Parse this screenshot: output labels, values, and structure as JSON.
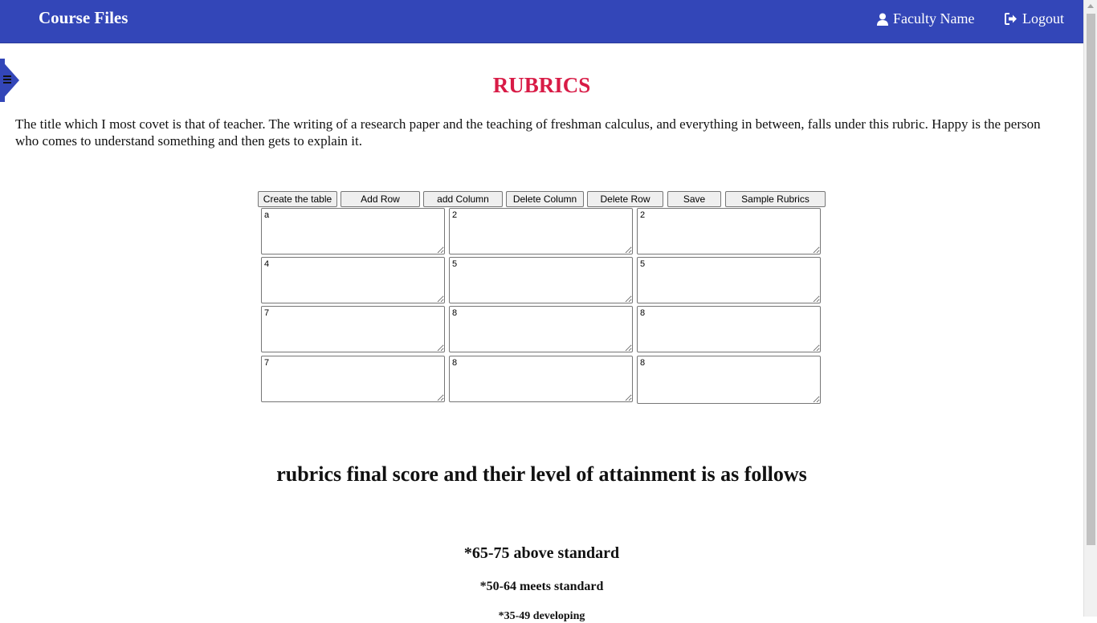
{
  "navbar": {
    "brand": "Course Files",
    "user_label": "Faculty Name",
    "logout_label": "Logout",
    "color": "#3346b8"
  },
  "page": {
    "title": "RUBRICS",
    "title_color": "#d81b46",
    "intro": "The title which I most covet is that of teacher. The writing of a research paper and the teaching of freshman calculus, and everything in between, falls under this rubric. Happy is the person who comes to understand something and then gets to explain it."
  },
  "toolbar": {
    "create": "Create the table",
    "add_row": "Add Row",
    "add_column": "add Column",
    "delete_column": "Delete Column",
    "delete_row": "Delete Row",
    "save": "Save",
    "sample": "Sample Rubrics"
  },
  "grid": {
    "rows": [
      [
        "a",
        "2",
        "2"
      ],
      [
        "4",
        "5",
        "5"
      ],
      [
        "7",
        "8",
        "8"
      ],
      [
        "7",
        "8",
        "8"
      ]
    ]
  },
  "attainment": {
    "heading": "rubrics final score and their level of attainment is as follows",
    "above": "*65-75 above standard",
    "meets": "*50-64 meets standard",
    "developing": "*35-49 developing"
  }
}
